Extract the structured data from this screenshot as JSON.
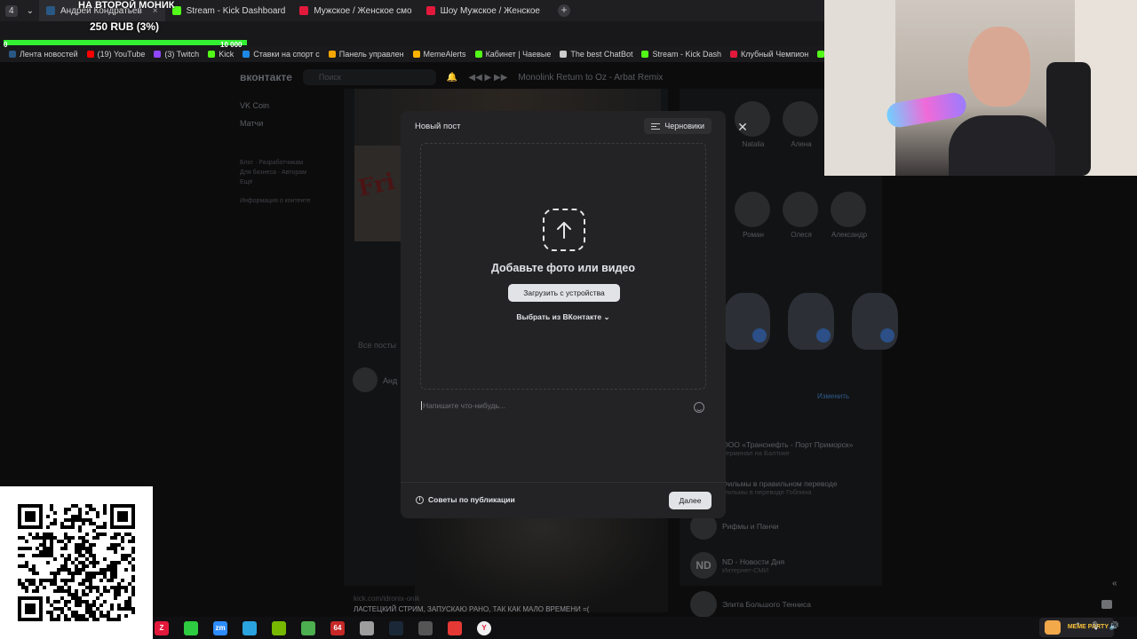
{
  "browser": {
    "tabs": [
      {
        "label": "Андрей Кондратьев",
        "icon": "vk-icon",
        "color": "#2a5885"
      },
      {
        "label": "Stream - Kick Dashboard",
        "icon": "kick-icon",
        "color": "#53fc18"
      },
      {
        "label": "Мужское / Женское смо",
        "icon": "r-icon",
        "color": "#e3193c"
      },
      {
        "label": "Шоу Мужское / Женское",
        "icon": "r-icon",
        "color": "#e3193c"
      }
    ],
    "bookmarks": [
      {
        "label": "Лента новостей",
        "color": "#2a5885"
      },
      {
        "label": "(19) YouTube",
        "color": "#ff0000"
      },
      {
        "label": "(3) Twitch",
        "color": "#9146ff"
      },
      {
        "label": "Kick",
        "color": "#53fc18"
      },
      {
        "label": "Ставки на спорт с",
        "color": "#1e88e5"
      },
      {
        "label": "Панель управлен",
        "color": "#f7a600"
      },
      {
        "label": "MemeAlerts",
        "color": "#ffb300"
      },
      {
        "label": "Кабинет | Чаевые",
        "color": "#53fc18"
      },
      {
        "label": "The best ChatBot",
        "color": "#cccccc"
      },
      {
        "label": "Stream - Kick Dash",
        "color": "#53fc18"
      },
      {
        "label": "Клубный Чемпион",
        "color": "#e3193c"
      },
      {
        "label": "Спо",
        "color": "#53fc18"
      }
    ]
  },
  "donation": {
    "title": "НА ВТОРОЙ МОНИК",
    "amount": "250 RUB (3%)",
    "min": "0",
    "max": "10 000",
    "progress_percent": 3
  },
  "vk": {
    "logo": "вконтакте",
    "search_placeholder": "Поиск",
    "player_track": "Monolink Return to Oz - Arbat Remix",
    "left_menu": [
      "VK Coin",
      "Матчи"
    ],
    "left_footer": [
      "Блог · Разработчикам",
      "Для бизнеса · Авторам",
      "Ещё"
    ],
    "left_info": "Информация о контенте",
    "all_posts": "Все посты",
    "author_short": "Анд",
    "caption_link": "kick.com/idronix-onik",
    "caption_text": "ЛАСТЕЦКИЙ СТРИМ, ЗАПУСКАЮ РАНО, ТАК КАК МАЛО ВРЕМЕНИ =(",
    "friends_row1": [
      "Natalia",
      "Алена"
    ],
    "friends_row2": [
      "Роман",
      "Олеся",
      "Александр"
    ],
    "change_link": "Изменить",
    "groups": [
      {
        "name": "ООО «Транснефть - Порт Приморск»",
        "sub": "Терминал на Балтике",
        "icon": ""
      },
      {
        "name": "Фильмы в правильном переводе",
        "sub": "Фильмы в переводе Гоблина",
        "icon": ""
      },
      {
        "name": "Рифмы и Панчи",
        "sub": "",
        "icon": ""
      },
      {
        "name": "ND - Новости Дня",
        "sub": "Интернет-СМИ",
        "icon": "ND"
      },
      {
        "name": "Элита Большого Тенниса",
        "sub": "",
        "icon": ""
      }
    ]
  },
  "modal": {
    "title": "Новый пост",
    "drafts": "Черновики",
    "dropzone_title": "Добавьте фото или видео",
    "upload_button": "Загрузить с устройства",
    "choose_vk": "Выбрать из ВКонтакте",
    "placeholder": "Напишите что-нибудь...",
    "tips": "Советы по публикации",
    "next": "Далее"
  },
  "taskbar": {
    "icons": [
      {
        "name": "z-app-icon",
        "label": "Z",
        "color": "#e3193c"
      },
      {
        "name": "battery-app-icon",
        "label": "",
        "color": "#2ecc40"
      },
      {
        "name": "zoom-icon",
        "label": "zm",
        "color": "#2d8cff"
      },
      {
        "name": "telegram-icon",
        "label": "",
        "color": "#2aa3df"
      },
      {
        "name": "nvidia-icon",
        "label": "",
        "color": "#76b900"
      },
      {
        "name": "map-app-icon",
        "label": "",
        "color": "#4caf50"
      },
      {
        "name": "counter-app-icon",
        "label": "64",
        "color": "#c62828"
      },
      {
        "name": "files-icon",
        "label": "",
        "color": "#9e9e9e"
      },
      {
        "name": "steam-icon",
        "label": "",
        "color": "#1b2838"
      },
      {
        "name": "chip-icon",
        "label": "",
        "color": "#555555"
      },
      {
        "name": "obs-icon",
        "label": "",
        "color": "#e53935"
      },
      {
        "name": "yandex-browser-icon",
        "label": "Y",
        "color": "#f0f0f0"
      }
    ],
    "meme_badge": "MEME PARTY"
  }
}
